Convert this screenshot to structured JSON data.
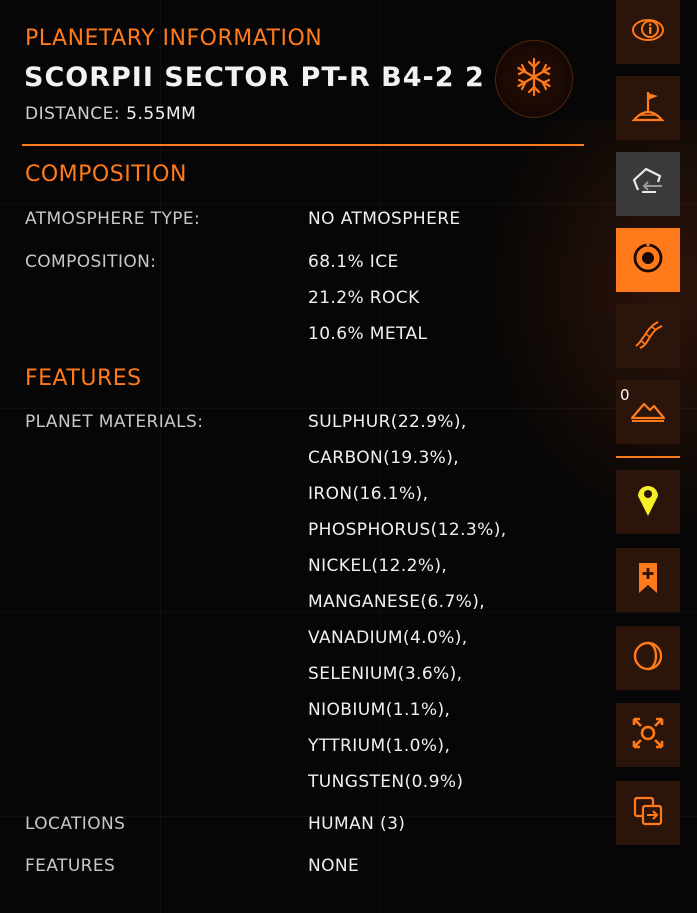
{
  "header": {
    "section_title": "PLANETARY INFORMATION",
    "planet_name": "SCORPII SECTOR PT-R B4-2 2",
    "distance_label": "DISTANCE:",
    "distance_value": "5.55MM",
    "badge_icon": "snowflake-icon"
  },
  "composition": {
    "heading": "COMPOSITION",
    "atmosphere_label": "ATMOSPHERE TYPE:",
    "atmosphere_value": "NO ATMOSPHERE",
    "composition_label": "COMPOSITION:",
    "composition_values": [
      "68.1% ICE",
      "21.2% ROCK",
      "10.6% METAL"
    ]
  },
  "features": {
    "heading": "FEATURES",
    "materials_label": "PLANET MATERIALS:",
    "materials": [
      "SULPHUR(22.9%),",
      "CARBON(19.3%),",
      "IRON(16.1%),",
      "PHOSPHORUS(12.3%),",
      "NICKEL(12.2%),",
      "MANGANESE(6.7%),",
      "VANADIUM(4.0%),",
      "SELENIUM(3.6%),",
      "NIOBIUM(1.1%),",
      "YTTRIUM(1.0%),",
      "TUNGSTEN(0.9%)"
    ],
    "locations_label": "LOCATIONS",
    "locations_value": "HUMAN (3)",
    "features_label": "FEATURES",
    "features_value": "NONE"
  },
  "sidebar": {
    "count_badge": "0",
    "buttons": [
      {
        "name": "info-icon",
        "state": "normal"
      },
      {
        "name": "planet-landing-flag-icon",
        "state": "normal"
      },
      {
        "name": "route-back-icon",
        "state": "disabled"
      },
      {
        "name": "target-orbit-icon",
        "state": "active"
      },
      {
        "name": "biology-dna-icon",
        "state": "normal"
      },
      {
        "name": "terrain-mountain-icon",
        "state": "normal"
      },
      {
        "name": "map-pin-icon",
        "state": "normal"
      },
      {
        "name": "bookmark-add-icon",
        "state": "normal"
      },
      {
        "name": "moon-phase-icon",
        "state": "normal"
      },
      {
        "name": "focus-scan-icon",
        "state": "normal"
      },
      {
        "name": "switch-view-icon",
        "state": "normal"
      }
    ]
  },
  "colors": {
    "accent": "#ff7a1a",
    "background": "#060606",
    "button_bg": "#2b1409",
    "button_disabled": "#3a3a3a",
    "pin_yellow": "#f6ee27"
  }
}
